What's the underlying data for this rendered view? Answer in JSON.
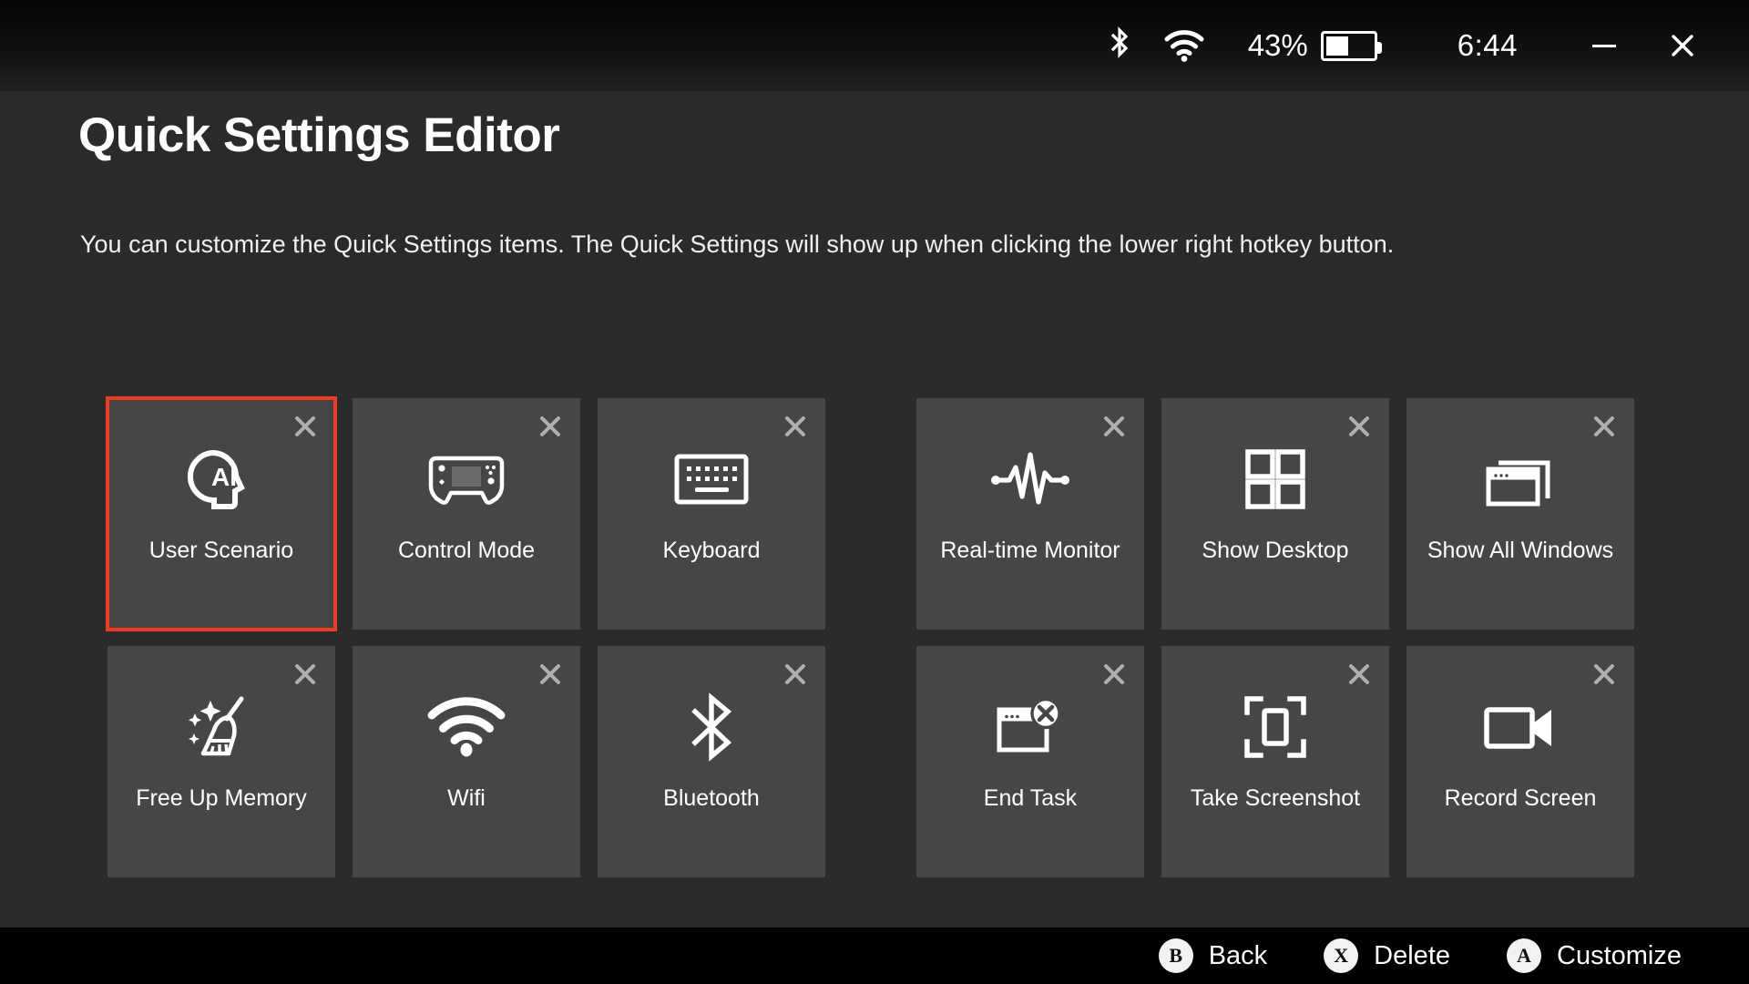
{
  "statusbar": {
    "bluetooth_icon": "bluetooth-icon",
    "wifi_icon": "wifi-icon",
    "battery_percent_label": "43%",
    "battery_level": 43,
    "clock": "6:44",
    "minimize_label": "—",
    "close_label": "✕"
  },
  "header": {
    "title": "Quick Settings Editor",
    "description": "You can customize the Quick Settings items. The Quick Settings will show up when clicking the lower right hotkey button."
  },
  "colors": {
    "page_background": "#2a2a2a",
    "tile_background": "#464646",
    "selection_accent": "#ef3b23",
    "bottom_bar": "#000000",
    "text": "#ffffff",
    "remove_icon": "#b0b0b0"
  },
  "tiles": {
    "remove_icon_name": "close-icon",
    "rows": [
      {
        "left_group": [
          {
            "label": "User Scenario",
            "icon": "ai-head-icon",
            "selected": true
          },
          {
            "label": "Control Mode",
            "icon": "handheld-console-icon",
            "selected": false
          },
          {
            "label": "Keyboard",
            "icon": "keyboard-icon",
            "selected": false
          }
        ],
        "right_group": [
          {
            "label": "Real-time Monitor",
            "icon": "waveform-pulse-icon",
            "selected": false
          },
          {
            "label": "Show Desktop",
            "icon": "four-squares-icon",
            "selected": false
          },
          {
            "label": "Show All Windows",
            "icon": "stacked-windows-icon",
            "selected": false
          }
        ]
      },
      {
        "left_group": [
          {
            "label": "Free Up Memory",
            "icon": "broom-sparkle-icon",
            "selected": false
          },
          {
            "label": "Wifi",
            "icon": "wifi-icon",
            "selected": false
          },
          {
            "label": "Bluetooth",
            "icon": "bluetooth-icon",
            "selected": false
          }
        ],
        "right_group": [
          {
            "label": "End Task",
            "icon": "window-close-icon",
            "selected": false
          },
          {
            "label": "Take Screenshot",
            "icon": "crop-frame-icon",
            "selected": false
          },
          {
            "label": "Record Screen",
            "icon": "video-camera-icon",
            "selected": false
          }
        ]
      }
    ]
  },
  "bottombar": {
    "hints": [
      {
        "button": "B",
        "label": "Back"
      },
      {
        "button": "X",
        "label": "Delete"
      },
      {
        "button": "A",
        "label": "Customize"
      }
    ]
  }
}
